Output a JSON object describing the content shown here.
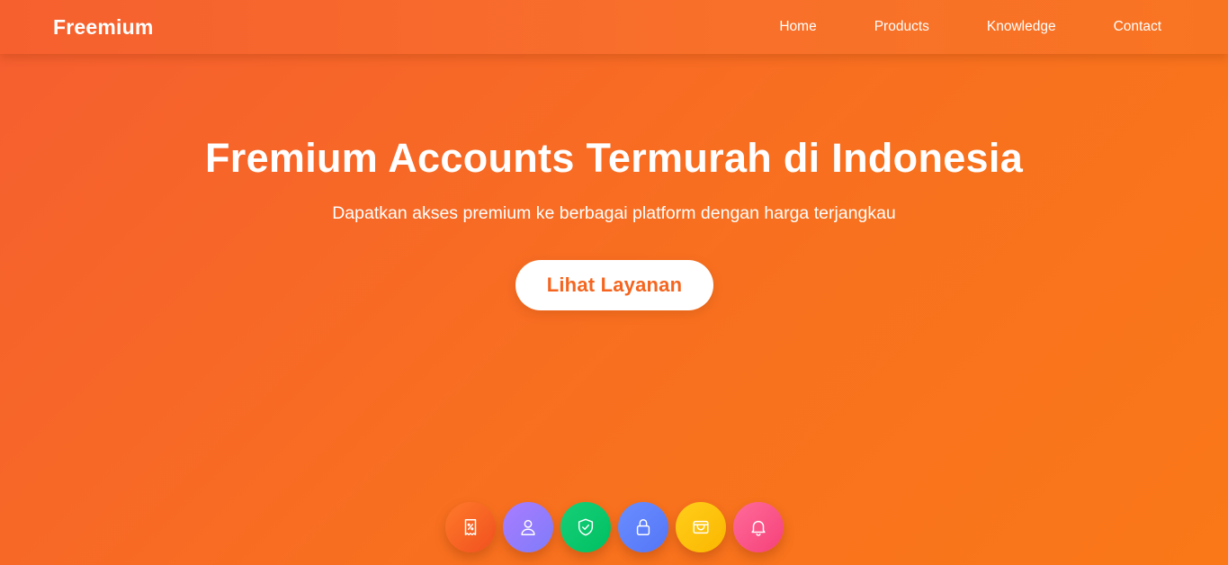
{
  "navbar": {
    "brand": "Freemium",
    "links": [
      {
        "label": "Home"
      },
      {
        "label": "Products"
      },
      {
        "label": "Knowledge"
      },
      {
        "label": "Contact"
      }
    ]
  },
  "hero": {
    "title": "Fremium Accounts Termurah di Indonesia",
    "subtitle": "Dapatkan akses premium ke berbagai platform dengan harga terjangkau",
    "cta_label": "Lihat Layanan"
  },
  "feature_icons": [
    {
      "icon": "discount-receipt-icon",
      "color": "#f8662a"
    },
    {
      "icon": "user-icon",
      "color": "#8f7cfb"
    },
    {
      "icon": "shield-check-icon",
      "color": "#06c76c"
    },
    {
      "icon": "lock-icon",
      "color": "#5d80fa"
    },
    {
      "icon": "wallet-icon",
      "color": "#fdc20d"
    },
    {
      "icon": "bell-icon",
      "color": "#f95787"
    }
  ],
  "colors": {
    "background_start": "#f65e30",
    "background_end": "#fa7818",
    "cta_text": "#f5651f",
    "text": "#ffffff"
  }
}
